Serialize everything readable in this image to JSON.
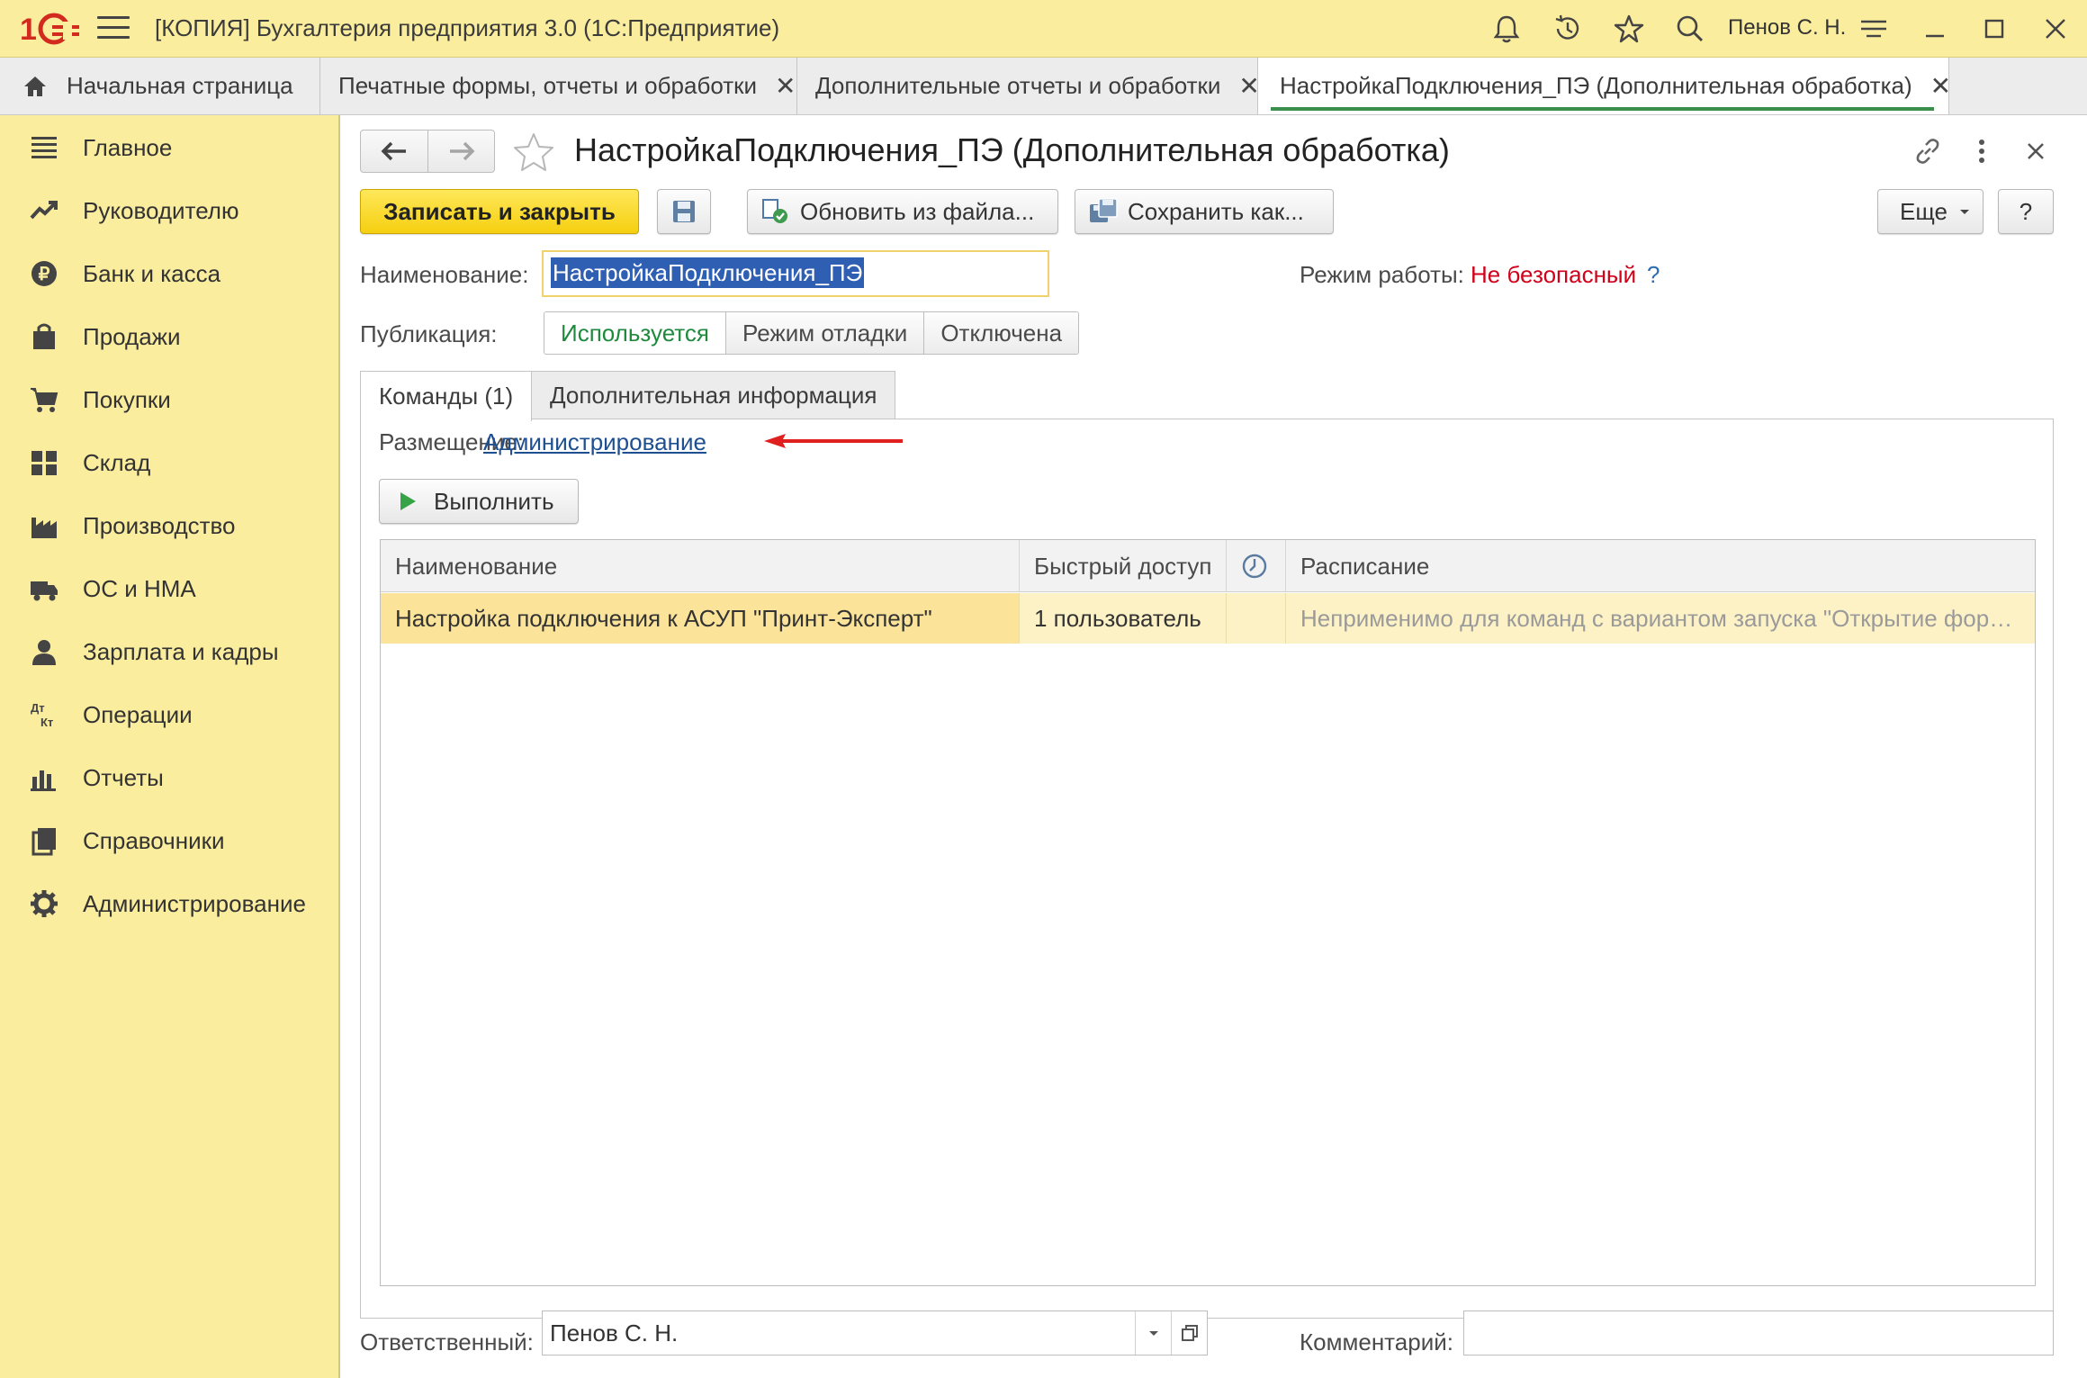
{
  "app": {
    "title": "[КОПИЯ] Бухгалтерия предприятия 3.0  (1С:Предприятие)",
    "user": "Пенов С. Н.",
    "icons": [
      "bell-icon",
      "history-icon",
      "star-icon",
      "search-icon",
      "settings-icon",
      "minimize-icon",
      "maximize-icon",
      "close-icon"
    ],
    "accent_color": "#fbed9e"
  },
  "tabs": {
    "home_label": "Начальная страница",
    "items": [
      {
        "label": "Печатные формы, отчеты и обработки"
      },
      {
        "label": "Дополнительные отчеты и обработки"
      },
      {
        "label": "НастройкаПодключения_ПЭ (Дополнительная обработка)",
        "active": true
      }
    ]
  },
  "sidebar": {
    "items": [
      {
        "label": "Главное",
        "icon": "list-icon"
      },
      {
        "label": "Руководителю",
        "icon": "trend-icon"
      },
      {
        "label": "Банк и касса",
        "icon": "ruble-icon"
      },
      {
        "label": "Продажи",
        "icon": "bag-icon"
      },
      {
        "label": "Покупки",
        "icon": "cart-icon"
      },
      {
        "label": "Склад",
        "icon": "warehouse-icon"
      },
      {
        "label": "Производство",
        "icon": "factory-icon"
      },
      {
        "label": "ОС и НМА",
        "icon": "truck-icon"
      },
      {
        "label": "Зарплата и кадры",
        "icon": "person-icon"
      },
      {
        "label": "Операции",
        "icon": "dt-kt-icon"
      },
      {
        "label": "Отчеты",
        "icon": "bar-chart-icon"
      },
      {
        "label": "Справочники",
        "icon": "books-icon"
      },
      {
        "label": "Администрирование",
        "icon": "gear-icon"
      }
    ]
  },
  "form": {
    "title": "НастройкаПодключения_ПЭ (Дополнительная обработка)",
    "toolbar": {
      "save_close": "Записать и закрыть",
      "update_from_file": "Обновить из файла...",
      "save_as": "Сохранить как...",
      "more": "Еще",
      "help": "?"
    },
    "name_label": "Наименование:",
    "name_value": "НастройкаПодключения_ПЭ",
    "mode_label": "Режим работы:",
    "mode_value": "Не безопасный",
    "mode_help": "?",
    "mode_color": "#d0021b",
    "publication_label": "Публикация:",
    "publication_options": [
      {
        "label": "Используется",
        "selected": true
      },
      {
        "label": "Режим отладки",
        "selected": false
      },
      {
        "label": "Отключена",
        "selected": false
      }
    ],
    "form_tabs": [
      {
        "label": "Команды (1)",
        "active": true
      },
      {
        "label": "Дополнительная информация",
        "active": false
      }
    ],
    "placement_label": "Размещение:",
    "placement_value": "Администрирование",
    "execute_button": "Выполнить",
    "grid": {
      "columns": [
        "Наименование",
        "Быстрый доступ",
        "",
        "Расписание"
      ],
      "rows": [
        {
          "name": "Настройка подключения к АСУП \"Принт-Эксперт\"",
          "quick_access": "1 пользователь",
          "scheduled": "",
          "schedule": "Неприменимо для команд с вариантом запуска \"Открытие фор…"
        }
      ]
    },
    "responsible_label": "Ответственный:",
    "responsible_value": "Пенов С. Н.",
    "comment_label": "Комментарий:",
    "comment_value": ""
  }
}
